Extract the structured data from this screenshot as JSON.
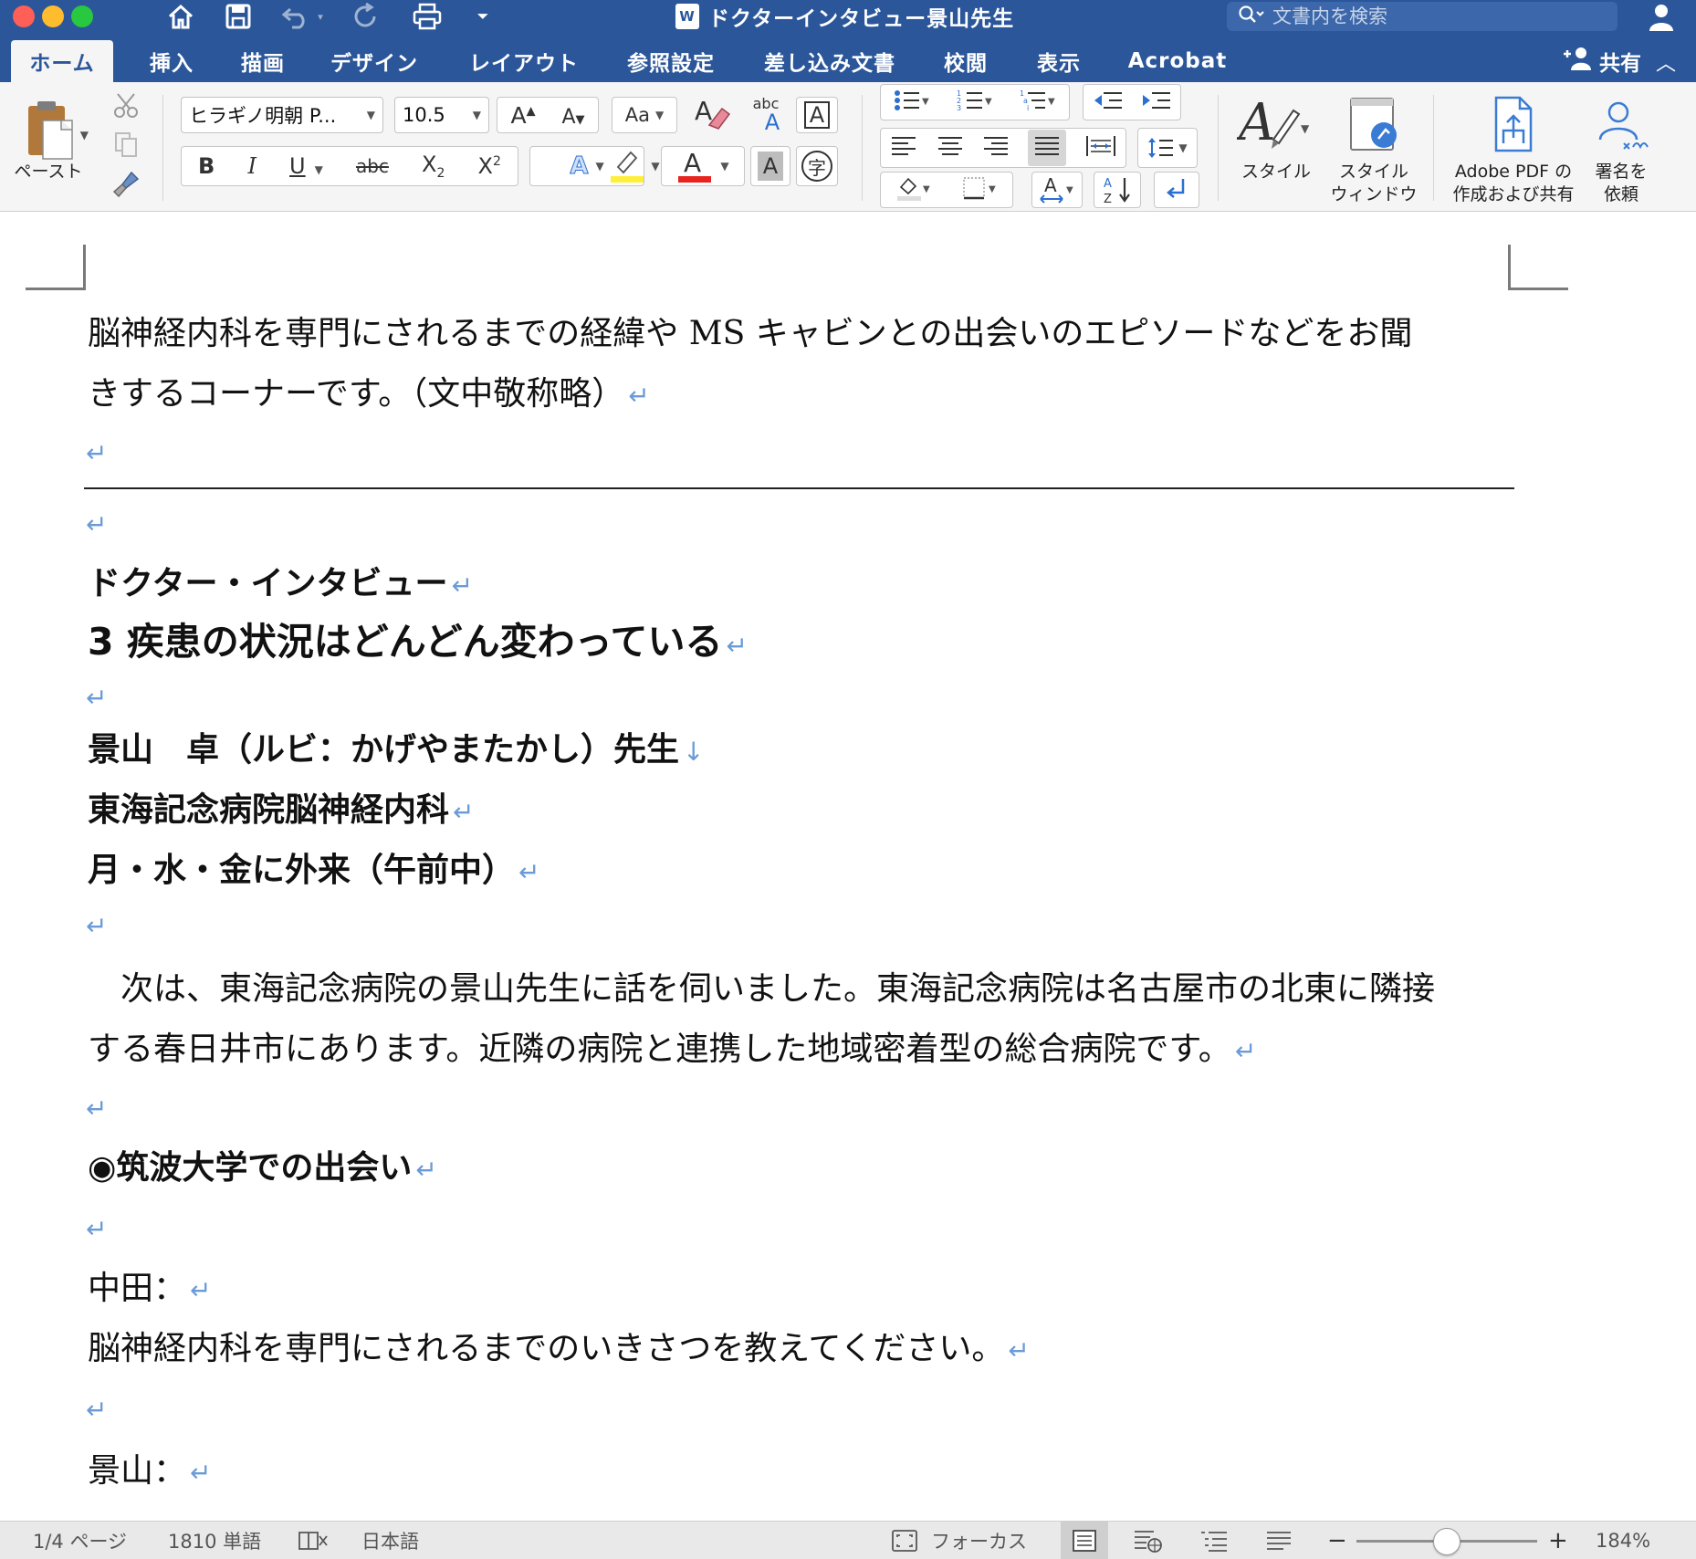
{
  "window": {
    "title": "ドクターインタビュー景山先生",
    "doc_icon": "W",
    "search_placeholder": "文書内を検索",
    "colors": {
      "close": "#fe5f57",
      "minimize": "#febc2e",
      "zoom": "#28c840",
      "accent": "#2b579a"
    }
  },
  "tabs": [
    {
      "label": "ホーム",
      "active": true
    },
    {
      "label": "挿入"
    },
    {
      "label": "描画"
    },
    {
      "label": "デザイン"
    },
    {
      "label": "レイアウト"
    },
    {
      "label": "参照設定"
    },
    {
      "label": "差し込み文書"
    },
    {
      "label": "校閲"
    },
    {
      "label": "表示"
    },
    {
      "label": "Acrobat"
    }
  ],
  "share_label": "共有",
  "ribbon": {
    "paste_label": "ペースト",
    "font_name": "ヒラギノ明朝 P...",
    "font_size": "10.5",
    "bold": "B",
    "italic": "I",
    "underline": "U",
    "strike": "abc",
    "subscript": "X",
    "subscript_mark": "2",
    "superscript": "X",
    "superscript_mark": "2",
    "grow_font": "A",
    "shrink_font": "A",
    "change_case": "Aa",
    "phonetic": "abc",
    "ruby_label": "字",
    "styles_label": "スタイル",
    "styles_pane_label_1": "スタイル",
    "styles_pane_label_2": "ウィンドウ",
    "adobe_label_1": "Adobe PDF の",
    "adobe_label_2": "作成および共有",
    "sign_label_1": "署名を",
    "sign_label_2": "依頼",
    "highlight_color": "#ffef3a",
    "font_color": "#e8241f"
  },
  "document": {
    "para1_line1": "脳神経内科を専門にされるまでの経緯や MS キャビンとの出会いのエピソードなどをお聞",
    "para1_line2": "きするコーナーです。（文中敬称略）",
    "heading_small": "ドクター・インタビュー",
    "heading_main": "3 疾患の状況はどんどん変わっている",
    "doctor_name": "景山　卓（ルビ：かげやまたかし）先生",
    "hospital": "東海記念病院脳神経内科",
    "schedule": "月・水・金に外来（午前中）",
    "para2_line1": "　次は、東海記念病院の景山先生に話を伺いました。東海記念病院は名古屋市の北東に隣接",
    "para2_line2": "する春日井市にあります。近隣の病院と連携した地域密着型の総合病院です。",
    "section_heading": "◉筑波大学での出会い",
    "speaker1": "中田：",
    "question1": "脳神経内科を専門にされるまでのいきさつを教えてください。",
    "speaker2": "景山："
  },
  "status": {
    "page": "1/4 ページ",
    "words": "1810 単語",
    "language": "日本語",
    "focus": "フォーカス",
    "zoom": "184%",
    "zoom_fraction": 0.5
  }
}
